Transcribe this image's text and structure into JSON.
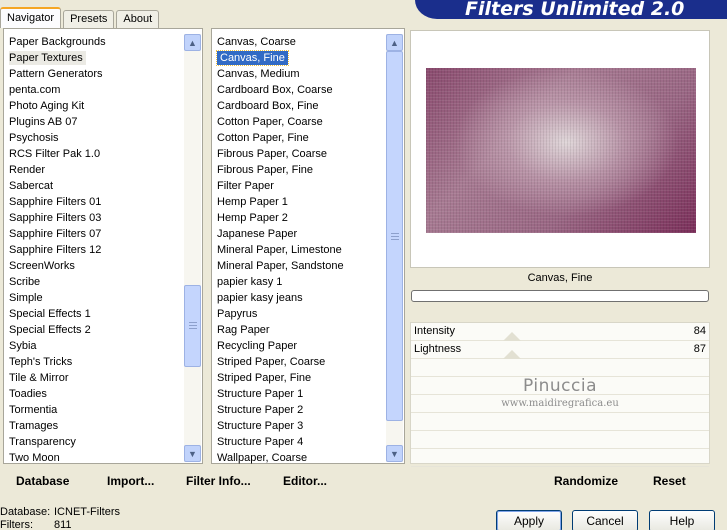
{
  "tabs": [
    "Navigator",
    "Presets",
    "About"
  ],
  "app_title": "Filters Unlimited 2.0",
  "categories": {
    "items": [
      "Paper Backgrounds",
      "Paper Textures",
      "Pattern Generators",
      "penta.com",
      "Photo Aging Kit",
      "Plugins AB 07",
      "Psychosis",
      "RCS Filter Pak 1.0",
      "Render",
      "Sabercat",
      "Sapphire Filters 01",
      "Sapphire Filters 03",
      "Sapphire Filters 07",
      "Sapphire Filters 12",
      "ScreenWorks",
      "Scribe",
      "Simple",
      "Special Effects 1",
      "Special Effects 2",
      "Sybia",
      "Teph's Tricks",
      "Tile & Mirror",
      "Toadies",
      "Tormentia",
      "Tramages",
      "Transparency",
      "Two Moon"
    ],
    "selected_index": 1,
    "scroll_fraction": 0.75
  },
  "filters": {
    "items": [
      "Canvas, Coarse",
      "Canvas, Fine",
      "Canvas, Medium",
      "Cardboard Box, Coarse",
      "Cardboard Box, Fine",
      "Cotton Paper, Coarse",
      "Cotton Paper, Fine",
      "Fibrous Paper, Coarse",
      "Fibrous Paper, Fine",
      "Filter Paper",
      "Hemp Paper 1",
      "Hemp Paper 2",
      "Japanese Paper",
      "Mineral Paper, Limestone",
      "Mineral Paper, Sandstone",
      "papier kasy 1",
      "papier kasy jeans",
      "Papyrus",
      "Rag Paper",
      "Recycling Paper",
      "Striped Paper, Coarse",
      "Striped Paper, Fine",
      "Structure Paper 1",
      "Structure Paper 2",
      "Structure Paper 3",
      "Structure Paper 4",
      "Wallpaper, Coarse"
    ],
    "selected_index": 1,
    "scroll_fraction": 0.0
  },
  "preview": {
    "filter_name": "Canvas, Fine"
  },
  "params": [
    {
      "label": "Intensity",
      "value": "84"
    },
    {
      "label": "Lightness",
      "value": "87"
    }
  ],
  "watermark": {
    "name": "Pinuccia",
    "site": "www.maidiregrafica.eu"
  },
  "toolbar": {
    "database": "Database",
    "import": "Import...",
    "filter_info": "Filter Info...",
    "editor": "Editor...",
    "randomize": "Randomize",
    "reset": "Reset"
  },
  "status": {
    "database_label": "Database:",
    "database_value": "ICNET-Filters",
    "filters_label": "Filters:",
    "filters_value": "811"
  },
  "buttons": {
    "apply": "Apply",
    "cancel": "Cancel",
    "help": "Help"
  },
  "colors": {
    "selection": "#316ac5",
    "banner": "#1a2e8c",
    "scrollbar": "#c1d3fb"
  }
}
